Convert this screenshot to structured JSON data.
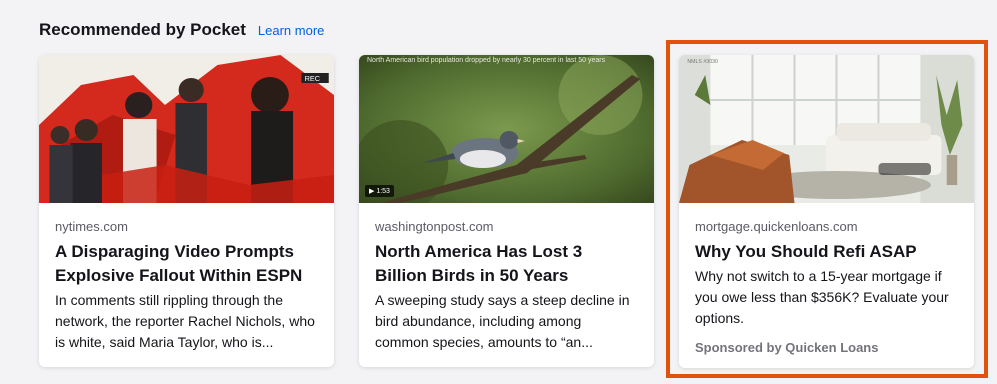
{
  "section": {
    "title": "Recommended by Pocket",
    "learn_more": "Learn more"
  },
  "cards": [
    {
      "source": "nytimes.com",
      "headline": "A Disparaging Video Prompts Explosive Fallout Within ESPN",
      "excerpt": "In comments still rippling through the network, the reporter Rachel Nichols, who is white, said Maria Taylor, who is...",
      "image_text": "REC"
    },
    {
      "source": "washingtonpost.com",
      "headline": "North America Has Lost 3 Billion Birds in 50 Years",
      "excerpt": "A sweeping study says a steep decline in bird abundance, including among common species, amounts to “an...",
      "image_caption": "North American bird population dropped by nearly 30 percent in last 50 years",
      "video_badge": "▶ 1:53"
    },
    {
      "source": "mortgage.quickenloans.com",
      "headline": "Why You Should Refi ASAP",
      "excerpt": "Why not switch to a 15-year mortgage if you owe less than $356K? Evaluate your options.",
      "sponsor": "Sponsored by Quicken Loans",
      "image_text": "NMLS #3030"
    }
  ],
  "colors": {
    "background": "#f3f3f6",
    "link": "#0061e0",
    "highlight": "#e2520d"
  }
}
